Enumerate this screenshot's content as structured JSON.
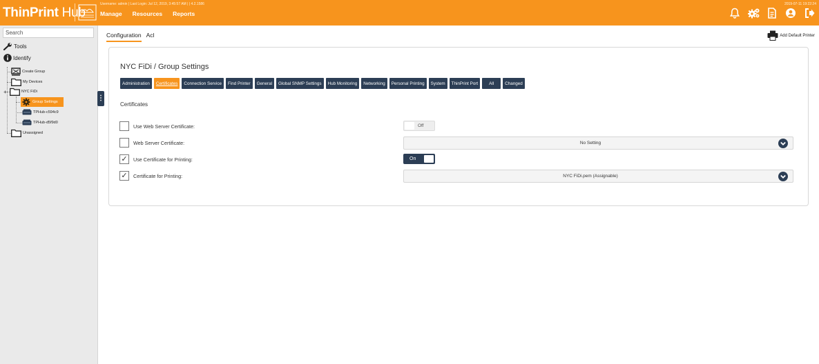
{
  "header": {
    "brand_bold": "ThinPrint",
    "brand_light": " Hub",
    "user_line": "Username: admin | Last Login: Jul 12, 2019, 3:45:57 AM |  |  4.2.1586",
    "datetime": "2019-07-11 19:22:24",
    "nav": [
      "Manage",
      "Resources",
      "Reports"
    ],
    "icons": [
      "bell-icon",
      "settings-gears-icon",
      "document-icon",
      "user-icon",
      "logout-icon"
    ]
  },
  "sidebar": {
    "search_placeholder": "Search",
    "tools": "Tools",
    "identify": "Identify",
    "tree": {
      "create_group": "Create Group",
      "my_devices": "My Devices",
      "nyc_fidi": "NYC FiDi",
      "group_settings": "Group Settings",
      "hub1": "TPHub-c594c9",
      "hub2": "TPHub-d5f9d0",
      "unassigned": "Unassigned"
    }
  },
  "main": {
    "subtabs": [
      "Configuration",
      "Acl"
    ],
    "add_printer": "Add Default Printer",
    "panel_title": "NYC FiDi / Group Settings",
    "category_tabs": [
      "Administration",
      "Certificates",
      "Connection Service",
      "Find Printer",
      "General",
      "Global SNMP Settings",
      "Hub Monitoring",
      "Networking",
      "Personal Printing",
      "System",
      "ThinPrint Port",
      "All",
      "Changed"
    ],
    "active_tab": "Certificates",
    "section_title": "Certificates",
    "rows": [
      {
        "label": "Use Web Server Certificate:",
        "checked": "",
        "control": "toggle",
        "value": "Off"
      },
      {
        "label": "Web Server Certificate:",
        "checked": "",
        "control": "select",
        "value": "No Setting"
      },
      {
        "label": "Use Certificate for Printing:",
        "checked": "✓",
        "control": "toggle",
        "value": "On"
      },
      {
        "label": "Certificate for Printing:",
        "checked": "✓",
        "control": "select",
        "value": "NYC FiDi.pem (Assignable)"
      }
    ]
  },
  "colors": {
    "accent": "#f7941d",
    "navy": "#2c3e55"
  }
}
